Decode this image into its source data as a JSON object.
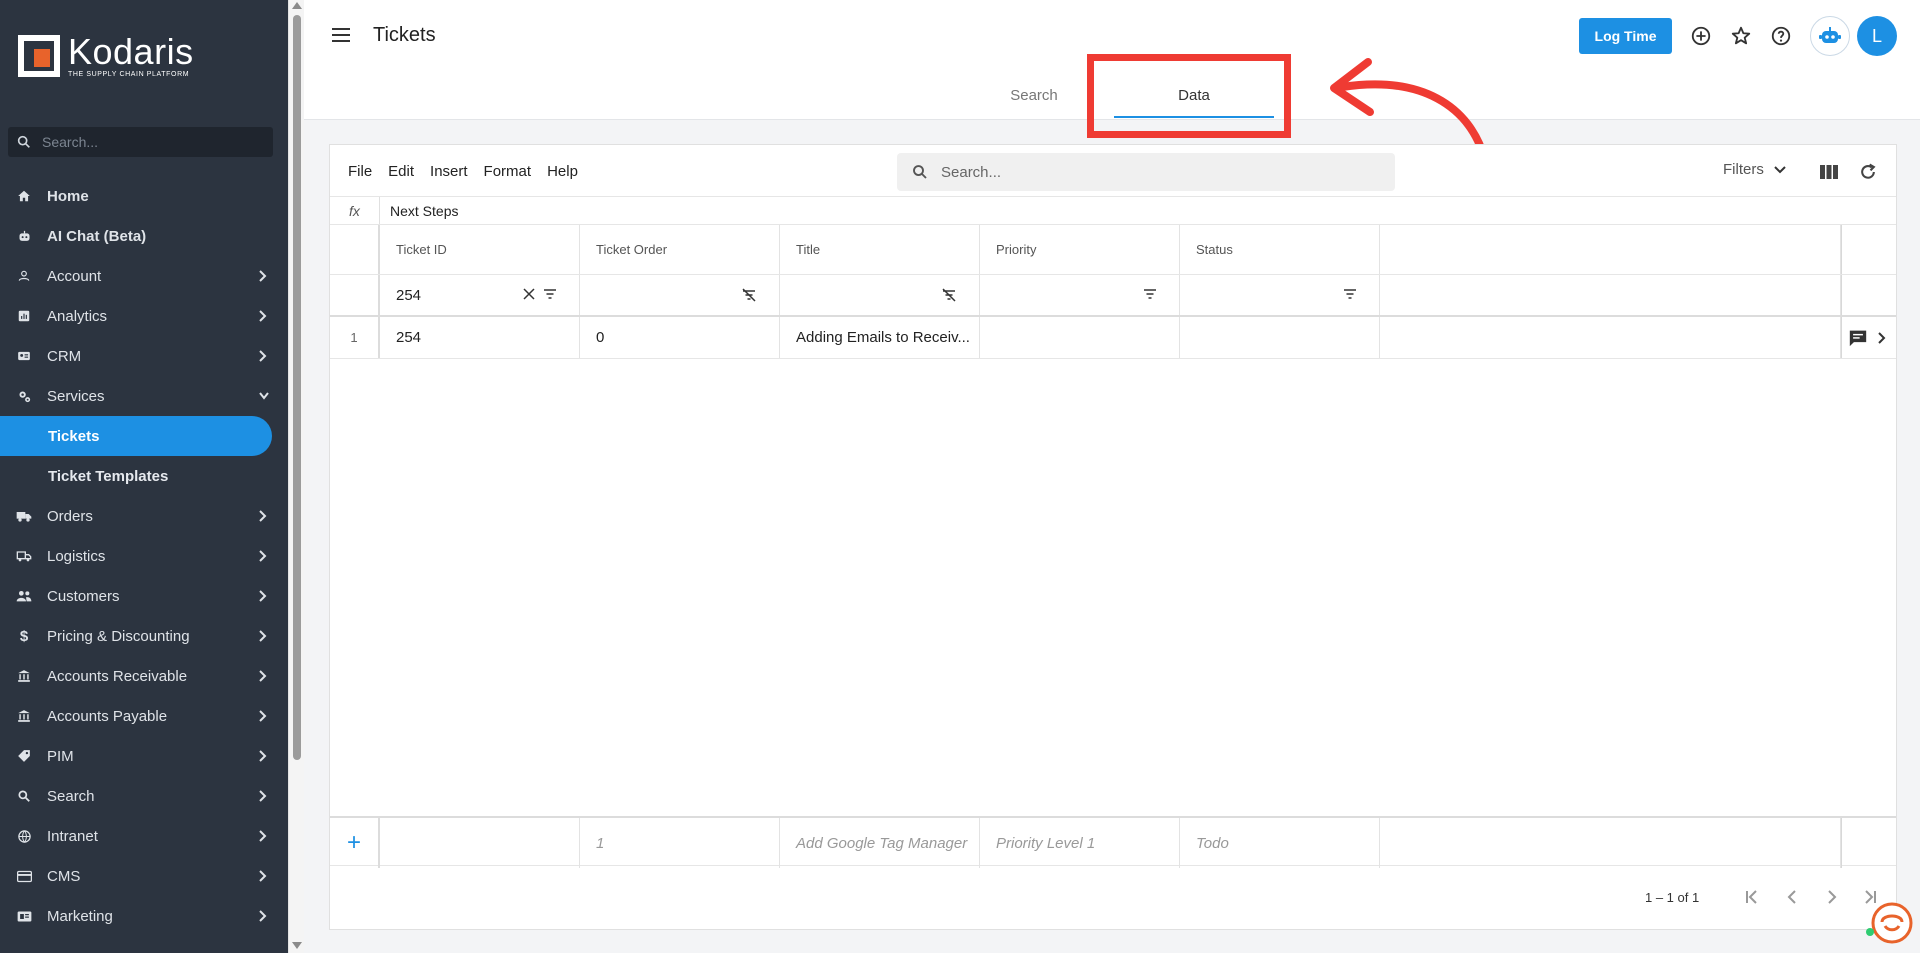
{
  "brand": {
    "name": "Kodaris",
    "tagline": "THE SUPPLY CHAIN PLATFORM"
  },
  "sidebar": {
    "search_placeholder": "Search...",
    "items": [
      {
        "label": "Home",
        "icon": "home-icon"
      },
      {
        "label": "AI Chat (Beta)",
        "icon": "bot-icon"
      },
      {
        "label": "Account",
        "icon": "person-icon"
      },
      {
        "label": "Analytics",
        "icon": "chart-icon"
      },
      {
        "label": "CRM",
        "icon": "contact-icon"
      },
      {
        "label": "Services",
        "icon": "gears-icon"
      },
      {
        "label": "Orders",
        "icon": "truck-icon"
      },
      {
        "label": "Logistics",
        "icon": "shipping-icon"
      },
      {
        "label": "Customers",
        "icon": "people-icon"
      },
      {
        "label": "Pricing & Discounting",
        "icon": "dollar-icon"
      },
      {
        "label": "Accounts Receivable",
        "icon": "bank-icon"
      },
      {
        "label": "Accounts Payable",
        "icon": "bank-icon"
      },
      {
        "label": "PIM",
        "icon": "tag-icon"
      },
      {
        "label": "Search",
        "icon": "search-icon"
      },
      {
        "label": "Intranet",
        "icon": "globe-icon"
      },
      {
        "label": "CMS",
        "icon": "card-icon"
      },
      {
        "label": "Marketing",
        "icon": "megaphone-icon"
      }
    ],
    "services_sub": [
      {
        "label": "Tickets"
      },
      {
        "label": "Ticket Templates"
      }
    ]
  },
  "header": {
    "title": "Tickets",
    "log_time": "Log Time",
    "avatar_initial": "L",
    "tabs": [
      {
        "label": "Search"
      },
      {
        "label": "Data"
      }
    ]
  },
  "toolbar": {
    "menu": [
      "File",
      "Edit",
      "Insert",
      "Format",
      "Help"
    ],
    "search_placeholder": "Search...",
    "filters_label": "Filters"
  },
  "formula_bar": {
    "fx": "fx",
    "value": "Next Steps"
  },
  "table": {
    "columns": [
      "Ticket ID",
      "Ticket Order",
      "Title",
      "Priority",
      "Status"
    ],
    "filters": {
      "ticket_id": "254"
    },
    "rows": [
      {
        "num": "1",
        "ticket_id": "254",
        "ticket_order": "0",
        "title": "Adding Emails to Receiv...",
        "priority": "",
        "status": ""
      }
    ],
    "new_row": {
      "add": "+",
      "ticket_order": "1",
      "title": "Add Google Tag Manager",
      "priority": "Priority Level 1",
      "status": "Todo"
    },
    "pagination": "1 – 1 of 1"
  },
  "colors": {
    "accent": "#1d90e3",
    "sidebar": "#2c3440",
    "annotation": "#ef3b33",
    "logo_orange": "#e8632b"
  }
}
